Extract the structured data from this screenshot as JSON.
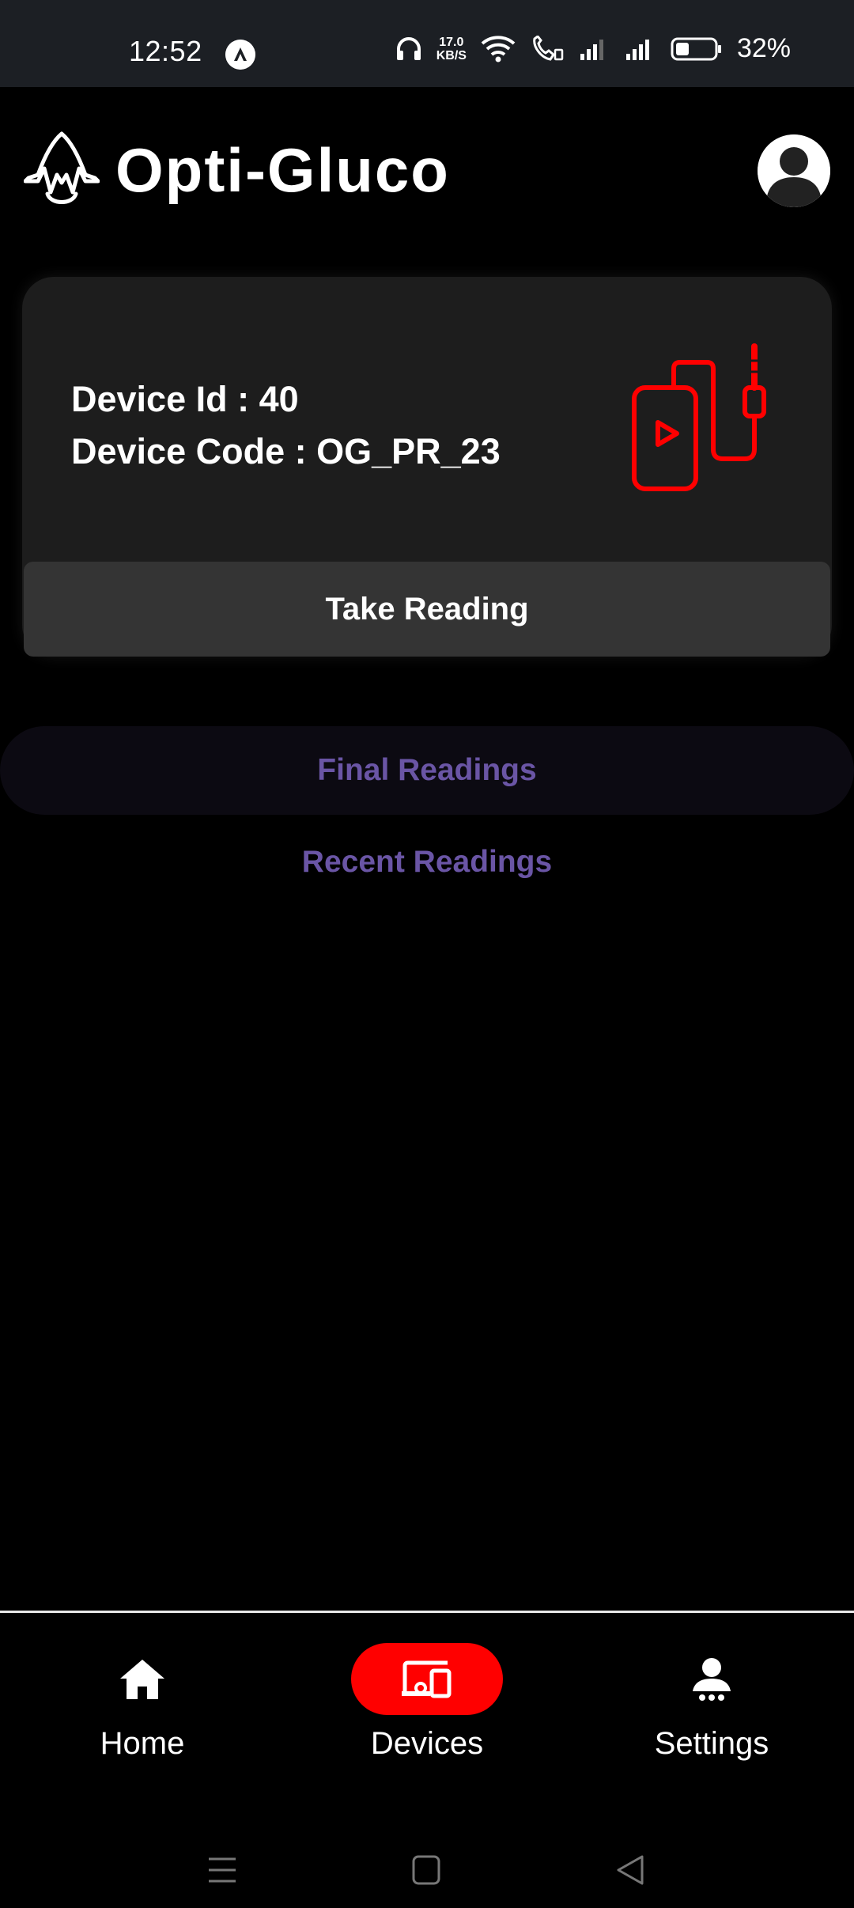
{
  "status_bar": {
    "time": "12:52",
    "net_speed_value": "17.0",
    "net_speed_unit": "KB/S",
    "battery": "32%"
  },
  "header": {
    "app_name": "Opti-Gluco"
  },
  "device_card": {
    "device_id_label": "Device Id : 40",
    "device_code_label": "Device Code : OG_PR_23",
    "take_reading_label": "Take Reading"
  },
  "tabs": {
    "final_label": "Final Readings",
    "recent_label": "Recent Readings"
  },
  "bottom_nav": {
    "items": [
      {
        "label": "Home"
      },
      {
        "label": "Devices"
      },
      {
        "label": "Settings"
      }
    ]
  },
  "colors": {
    "accent": "#ff0000",
    "tab_text": "#6a55a5",
    "card_bg": "#1d1d1d",
    "button_bg": "#343434"
  }
}
